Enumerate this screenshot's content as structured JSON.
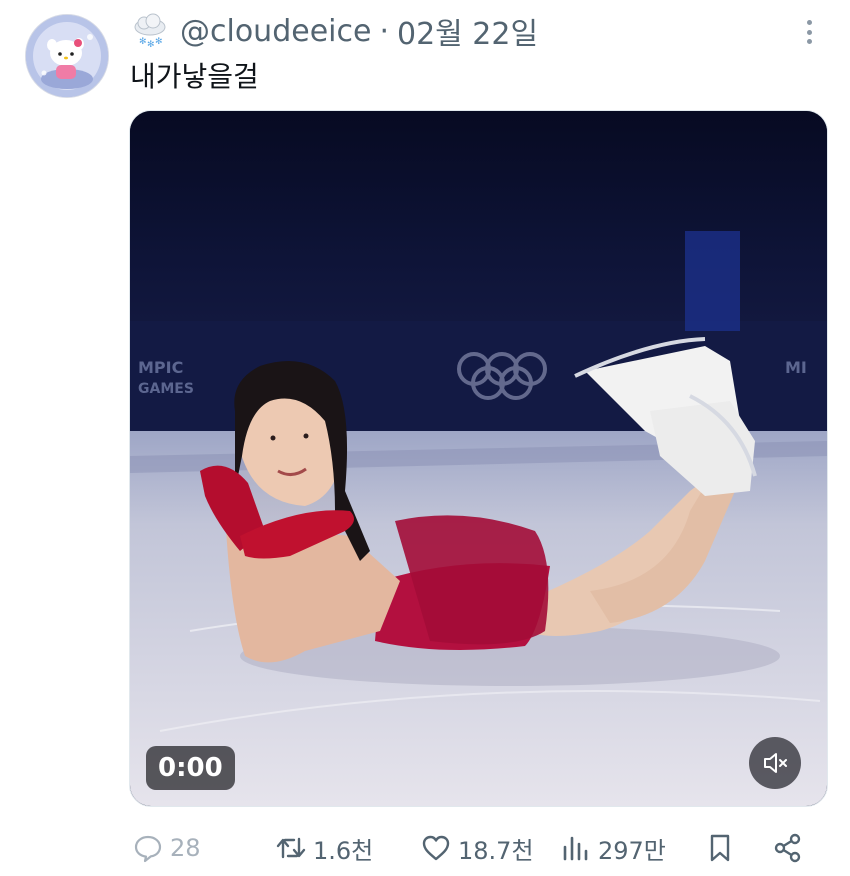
{
  "post": {
    "handle": "@cloudeeice",
    "separator": "·",
    "date": "02월 22일",
    "text": "내가낳을걸"
  },
  "media": {
    "type": "video",
    "timestamp": "0:00",
    "muted": true
  },
  "actions": {
    "replies": "28",
    "retweets": "1.6천",
    "likes": "18.7천",
    "views": "297만"
  },
  "colors": {
    "secondary_text": "#536471",
    "primary_text": "#0f1419",
    "dress": "#b0123c"
  },
  "icons": [
    "cloud-snow-emoji-icon",
    "more-options-icon",
    "mute-icon",
    "reply-icon",
    "retweet-icon",
    "like-icon",
    "views-icon",
    "bookmark-icon",
    "share-icon"
  ]
}
